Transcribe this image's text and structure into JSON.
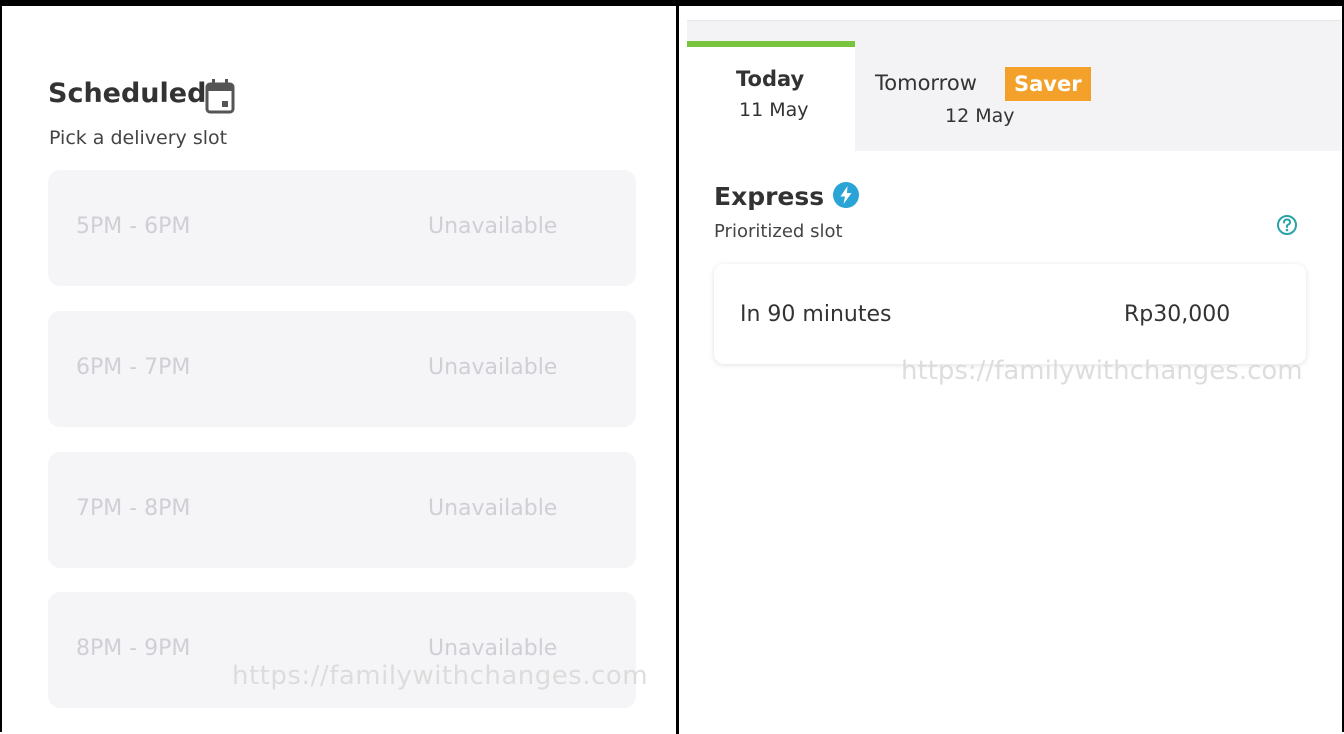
{
  "scheduled": {
    "title": "Scheduled",
    "subtitle": "Pick a delivery slot",
    "slots": [
      {
        "time": "5PM - 6PM",
        "status": "Unavailable"
      },
      {
        "time": "6PM - 7PM",
        "status": "Unavailable"
      },
      {
        "time": "7PM - 8PM",
        "status": "Unavailable"
      },
      {
        "time": "8PM - 9PM",
        "status": "Unavailable"
      }
    ],
    "watermark": "https://familywithchanges.com"
  },
  "tabs": {
    "today": {
      "label": "Today",
      "date": "11 May"
    },
    "tomorrow": {
      "label": "Tomorrow",
      "badge": "Saver",
      "date": "12 May"
    },
    "accent_color": "#78c53d",
    "badge_color": "#f3a12b"
  },
  "express": {
    "title": "Express",
    "subtitle": "Prioritized slot",
    "option": {
      "time": "In 90 minutes",
      "price": "Rp30,000"
    },
    "icon_color": "#2aa3d6",
    "watermark": "https://familywithchanges.com"
  }
}
